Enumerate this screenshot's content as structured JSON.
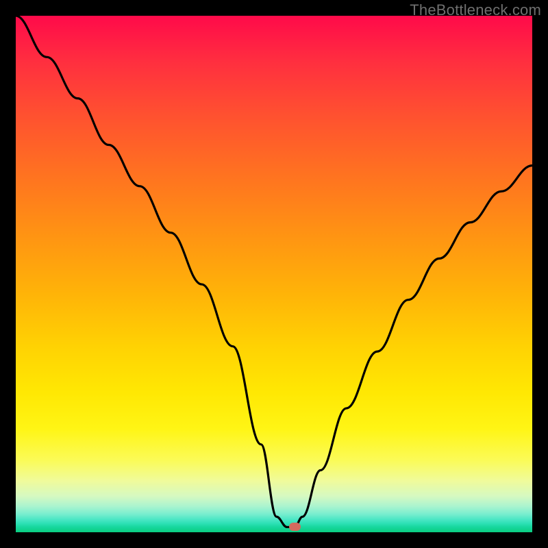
{
  "watermark": "TheBottleneck.com",
  "chart_data": {
    "type": "line",
    "title": "",
    "xlabel": "",
    "ylabel": "",
    "xlim": [
      0,
      100
    ],
    "ylim": [
      0,
      100
    ],
    "grid": false,
    "legend": false,
    "series": [
      {
        "name": "bottleneck-curve",
        "x": [
          0,
          6,
          12,
          18,
          24,
          30,
          36,
          42,
          47.5,
          50.5,
          52.5,
          54,
          55.5,
          59,
          64,
          70,
          76,
          82,
          88,
          94,
          100
        ],
        "y": [
          100,
          92,
          84,
          75,
          67,
          58,
          48,
          36,
          17,
          3,
          1,
          1,
          3,
          12,
          24,
          35,
          45,
          53,
          60,
          66,
          71
        ]
      }
    ],
    "marker": {
      "x": 54,
      "y": 1,
      "color": "#d36a5e"
    },
    "background": {
      "type": "vertical-gradient",
      "stops": [
        {
          "pos": 0.0,
          "color": "#ff0a4a"
        },
        {
          "pos": 0.5,
          "color": "#ffb408"
        },
        {
          "pos": 0.8,
          "color": "#fff515"
        },
        {
          "pos": 1.0,
          "color": "#0acd80"
        }
      ]
    }
  }
}
